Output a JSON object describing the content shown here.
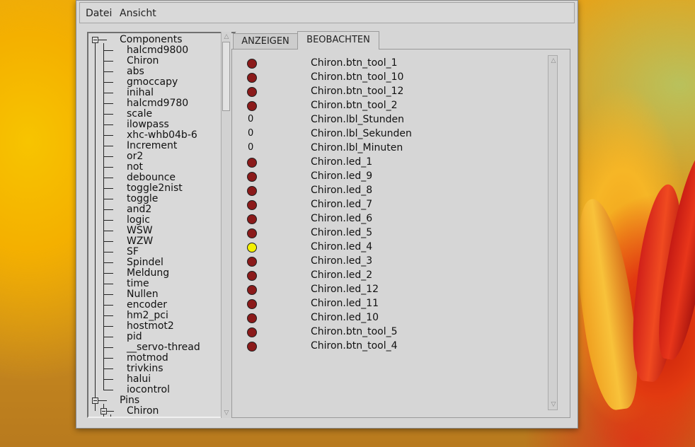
{
  "menu": {
    "items": [
      "Datei",
      "Ansicht"
    ]
  },
  "tree": {
    "root_label": "Components",
    "components": [
      "halcmd9800",
      "Chiron",
      "abs",
      "gmoccapy",
      "inihal",
      "halcmd9780",
      "scale",
      "ilowpass",
      "xhc-whb04b-6",
      "Increment",
      "or2",
      "not",
      "debounce",
      "toggle2nist",
      "toggle",
      "and2",
      "logic",
      "WSW",
      "WZW",
      "SF",
      "Spindel",
      "Meldung",
      "time",
      "Nullen",
      "encoder",
      "hm2_pci",
      "hostmot2",
      "pid",
      "__servo-thread",
      "motmod",
      "trivkins",
      "halui",
      "iocontrol"
    ],
    "pins_label": "Pins",
    "pins_children": [
      "Chiron"
    ]
  },
  "tabs": [
    "ANZEIGEN",
    "BEOBACHTEN"
  ],
  "active_tab": "BEOBACHTEN",
  "colors": {
    "led_off": "#8b1a1a",
    "led_on": "#f4f000"
  },
  "watch": [
    {
      "type": "led",
      "state": "off",
      "name": "Chiron.btn_tool_1"
    },
    {
      "type": "led",
      "state": "off",
      "name": "Chiron.btn_tool_10"
    },
    {
      "type": "led",
      "state": "off",
      "name": "Chiron.btn_tool_12"
    },
    {
      "type": "led",
      "state": "off",
      "name": "Chiron.btn_tool_2"
    },
    {
      "type": "value",
      "value": "0",
      "name": "Chiron.lbl_Stunden"
    },
    {
      "type": "value",
      "value": "0",
      "name": "Chiron.lbl_Sekunden"
    },
    {
      "type": "value",
      "value": "0",
      "name": "Chiron.lbl_Minuten"
    },
    {
      "type": "led",
      "state": "off",
      "name": "Chiron.led_1"
    },
    {
      "type": "led",
      "state": "off",
      "name": "Chiron.led_9"
    },
    {
      "type": "led",
      "state": "off",
      "name": "Chiron.led_8"
    },
    {
      "type": "led",
      "state": "off",
      "name": "Chiron.led_7"
    },
    {
      "type": "led",
      "state": "off",
      "name": "Chiron.led_6"
    },
    {
      "type": "led",
      "state": "off",
      "name": "Chiron.led_5"
    },
    {
      "type": "led",
      "state": "on",
      "name": "Chiron.led_4"
    },
    {
      "type": "led",
      "state": "off",
      "name": "Chiron.led_3"
    },
    {
      "type": "led",
      "state": "off",
      "name": "Chiron.led_2"
    },
    {
      "type": "led",
      "state": "off",
      "name": "Chiron.led_12"
    },
    {
      "type": "led",
      "state": "off",
      "name": "Chiron.led_11"
    },
    {
      "type": "led",
      "state": "off",
      "name": "Chiron.led_10"
    },
    {
      "type": "led",
      "state": "off",
      "name": "Chiron.btn_tool_5"
    },
    {
      "type": "led",
      "state": "off",
      "name": "Chiron.btn_tool_4"
    }
  ]
}
